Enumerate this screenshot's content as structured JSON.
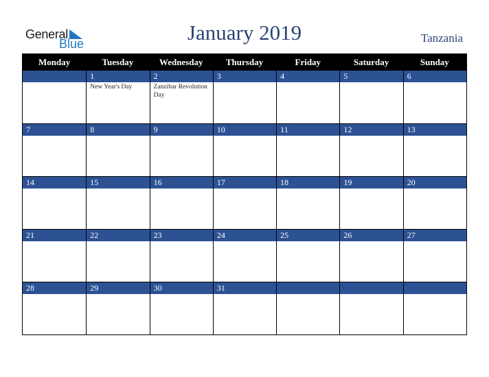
{
  "logo": {
    "word1": "General",
    "word2": "Blue",
    "icon": "triangle-flag-icon",
    "accent": "#1f78c1"
  },
  "title": "January 2019",
  "country": "Tanzania",
  "colors": {
    "header_bg": "#000000",
    "day_bar": "#2d5294",
    "title": "#2c4374"
  },
  "weekdays": [
    "Monday",
    "Tuesday",
    "Wednesday",
    "Thursday",
    "Friday",
    "Saturday",
    "Sunday"
  ],
  "weeks": [
    [
      {
        "day": ""
      },
      {
        "day": "1",
        "event": "New Year's Day"
      },
      {
        "day": "2",
        "event": "Zanzibar Revolution Day"
      },
      {
        "day": "3"
      },
      {
        "day": "4"
      },
      {
        "day": "5"
      },
      {
        "day": "6"
      }
    ],
    [
      {
        "day": "7"
      },
      {
        "day": "8"
      },
      {
        "day": "9"
      },
      {
        "day": "10"
      },
      {
        "day": "11"
      },
      {
        "day": "12"
      },
      {
        "day": "13"
      }
    ],
    [
      {
        "day": "14"
      },
      {
        "day": "15"
      },
      {
        "day": "16"
      },
      {
        "day": "17"
      },
      {
        "day": "18"
      },
      {
        "day": "19"
      },
      {
        "day": "20"
      }
    ],
    [
      {
        "day": "21"
      },
      {
        "day": "22"
      },
      {
        "day": "23"
      },
      {
        "day": "24"
      },
      {
        "day": "25"
      },
      {
        "day": "26"
      },
      {
        "day": "27"
      }
    ],
    [
      {
        "day": "28"
      },
      {
        "day": "29"
      },
      {
        "day": "30"
      },
      {
        "day": "31"
      },
      {
        "day": ""
      },
      {
        "day": ""
      },
      {
        "day": ""
      }
    ]
  ]
}
